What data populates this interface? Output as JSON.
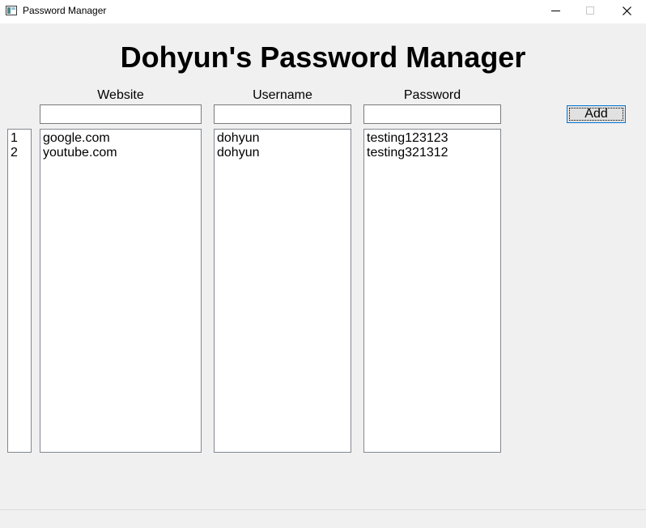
{
  "window": {
    "title": "Password Manager",
    "controls": [
      "minimize",
      "maximize",
      "close"
    ]
  },
  "heading": "Dohyun's Password Manager",
  "columns": {
    "website": "Website",
    "username": "Username",
    "password": "Password"
  },
  "inputs": {
    "website": "",
    "username": "",
    "password": ""
  },
  "add_button": "Add",
  "entries": {
    "index": [
      "1",
      "2"
    ],
    "websites": [
      "google.com",
      "youtube.com"
    ],
    "usernames": [
      "dohyun",
      "dohyun"
    ],
    "passwords": [
      "testing123123",
      "testing321312"
    ]
  },
  "colors": {
    "window_bg": "#f0f0f0",
    "titlebar_bg": "#ffffff",
    "focus_border": "#0078d7"
  }
}
